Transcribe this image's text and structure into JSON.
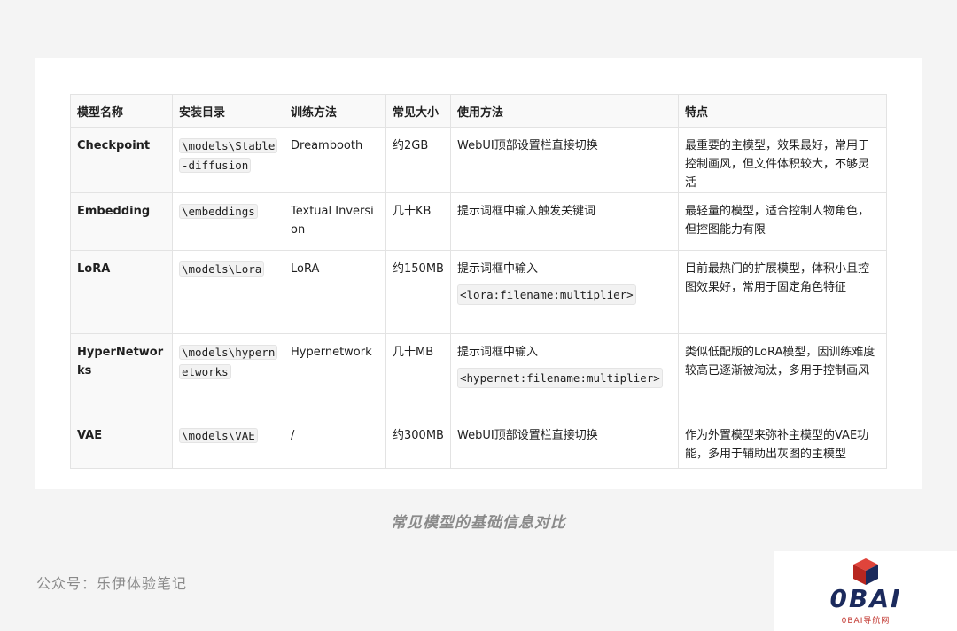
{
  "table": {
    "headers": [
      "模型名称",
      "安装目录",
      "训练方法",
      "常见大小",
      "使用方法",
      "特点"
    ],
    "rows": [
      {
        "name": "Checkpoint",
        "dir": "\\models\\Stable-diffusion",
        "method": "Dreambooth",
        "size": "约2GB",
        "usage_text": "WebUI顶部设置栏直接切换",
        "usage_code": "",
        "feature": "最重要的主模型，效果最好，常用于控制画风，但文件体积较大，不够灵活"
      },
      {
        "name": "Embedding",
        "dir": "\\embeddings",
        "method": "Textual Inversion",
        "size": "几十KB",
        "usage_text": "提示词框中输入触发关键词",
        "usage_code": "",
        "feature": "最轻量的模型，适合控制人物角色，但控图能力有限"
      },
      {
        "name": "LoRA",
        "dir": "\\models\\Lora",
        "method": "LoRA",
        "size": "约150MB",
        "usage_text": "提示词框中输入",
        "usage_code": "<lora:filename:multiplier>",
        "feature": "目前最热门的扩展模型，体积小且控图效果好，常用于固定角色特征"
      },
      {
        "name": "HyperNetworks",
        "dir": "\\models\\hypernetworks",
        "method": "Hypernetwork",
        "size": "几十MB",
        "usage_text": "提示词框中输入",
        "usage_code": "<hypernet:filename:multiplier>",
        "feature": "类似低配版的LoRA模型，因训练难度较高已逐渐被淘汰，多用于控制画风"
      },
      {
        "name": "VAE",
        "dir": "\\models\\VAE",
        "method": "/",
        "size": "约300MB",
        "usage_text": "WebUI顶部设置栏直接切换",
        "usage_code": "",
        "feature": "作为外置模型来弥补主模型的VAE功能，多用于辅助出灰图的主模型"
      }
    ]
  },
  "caption": "常见模型的基础信息对比",
  "signature": "公众号：乐伊体验笔记",
  "logo": {
    "text": "0BAI",
    "subtext": "0BAI导航网",
    "icon": "cube-logo-icon",
    "colors": {
      "red": "#d6332b",
      "navy": "#1b2a5c"
    }
  }
}
